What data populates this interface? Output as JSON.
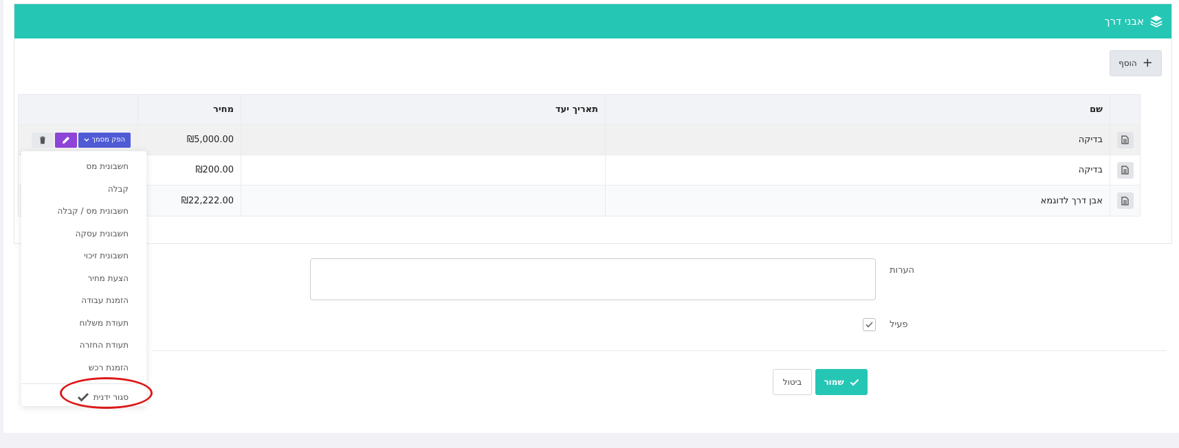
{
  "panel": {
    "title": "אבני דרך",
    "icon": "layers-icon"
  },
  "toolbar": {
    "add_label": "הוסף"
  },
  "table": {
    "headers": {
      "name": "שם",
      "target_date": "תאריך יעד",
      "price": "מחיר"
    },
    "rows": [
      {
        "name": "בדיקה",
        "target_date": "",
        "price": "₪5,000.00"
      },
      {
        "name": "בדיקה",
        "target_date": "",
        "price": "₪200.00"
      },
      {
        "name": "אבן דרך לדוגמא",
        "target_date": "",
        "price": "₪22,222.00"
      }
    ],
    "actions": {
      "produce_doc_label": "הפק מסמך"
    }
  },
  "dropdown": {
    "items": [
      "חשבונית מס",
      "קבלה",
      "חשבונית מס / קבלה",
      "חשבונית עסקה",
      "חשבונית זיכוי",
      "הצעת מחיר",
      "הזמנת עבודה",
      "תעודת משלוח",
      "תעודת החזרה",
      "הזמנת רכש"
    ],
    "close_label": "סגור ידנית"
  },
  "form": {
    "notes_label": "הערות",
    "notes_value": "",
    "active_label": "פעיל",
    "active_checked": true
  },
  "footer": {
    "save_label": "שמור",
    "cancel_label": "ביטול"
  },
  "colors": {
    "header": "#26c6b5",
    "produce_doc": "#4f5bd5",
    "edit": "#8e44d6",
    "highlight": "#dd1818"
  }
}
